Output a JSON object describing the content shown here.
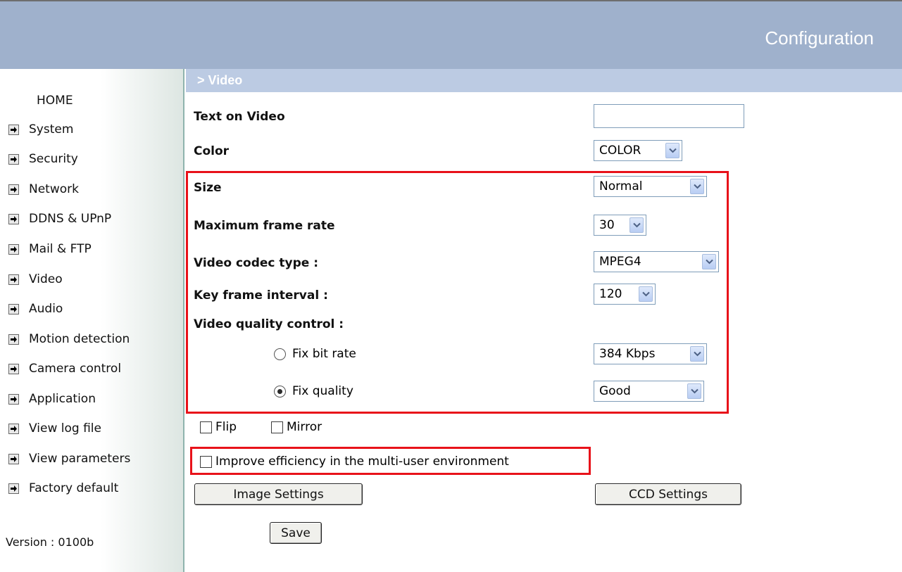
{
  "header": {
    "title": "Configuration"
  },
  "section": {
    "title": "> Video"
  },
  "sidebar": {
    "home": "HOME",
    "items": [
      {
        "label": "System"
      },
      {
        "label": "Security"
      },
      {
        "label": "Network"
      },
      {
        "label": "DDNS & UPnP"
      },
      {
        "label": "Mail & FTP"
      },
      {
        "label": "Video"
      },
      {
        "label": "Audio"
      },
      {
        "label": "Motion detection"
      },
      {
        "label": "Camera control"
      },
      {
        "label": "Application"
      },
      {
        "label": "View log file"
      },
      {
        "label": "View parameters"
      },
      {
        "label": "Factory default"
      }
    ],
    "version": "Version : 0100b"
  },
  "form": {
    "text_on_video": {
      "label": "Text on Video",
      "value": ""
    },
    "color": {
      "label": "Color",
      "value": "COLOR"
    },
    "size": {
      "label": "Size",
      "value": "Normal"
    },
    "max_frame_rate": {
      "label": "Maximum frame rate",
      "value": "30"
    },
    "codec": {
      "label": "Video codec type :",
      "value": "MPEG4"
    },
    "key_frame": {
      "label": "Key frame interval :",
      "value": "120"
    },
    "quality_control": {
      "label": "Video quality control :"
    },
    "fix_bit_rate": {
      "label": "Fix bit rate",
      "value": "384 Kbps",
      "checked": false
    },
    "fix_quality": {
      "label": "Fix quality",
      "value": "Good",
      "checked": true
    },
    "flip": {
      "label": "Flip",
      "checked": false
    },
    "mirror": {
      "label": "Mirror",
      "checked": false
    },
    "improve": {
      "label": "Improve efficiency in the multi-user environment",
      "checked": false
    }
  },
  "buttons": {
    "image_settings": "Image Settings",
    "ccd_settings": "CCD Settings",
    "save": "Save"
  },
  "colors": {
    "header_bg": "#9fb1cc",
    "section_bg": "#bccbe3",
    "highlight": "#e8121a"
  }
}
